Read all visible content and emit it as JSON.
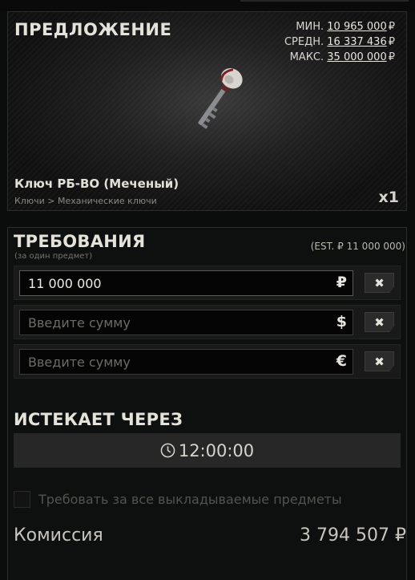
{
  "offer": {
    "title": "ПРЕДЛОЖЕНИЕ",
    "prices": [
      {
        "label": "МИН.",
        "value": "10 965 000",
        "currency": "₽"
      },
      {
        "label": "СРЕДН.",
        "value": "16 337 436",
        "currency": "₽"
      },
      {
        "label": "МАКС.",
        "value": "35 000 000",
        "currency": "₽"
      }
    ],
    "item_name": "Ключ РБ-ВО (Меченый)",
    "breadcrumb": "Ключи > Механические ключи",
    "quantity": "x1"
  },
  "requirements": {
    "title": "ТРЕБОВАНИЯ",
    "subtitle": "(за один предмет)",
    "estimate": "(EST. ₽ 11 000 000)",
    "fields": [
      {
        "value": "11 000 000",
        "placeholder": "",
        "symbol": "₽"
      },
      {
        "value": "",
        "placeholder": "Введите сумму",
        "symbol": "$"
      },
      {
        "value": "",
        "placeholder": "Введите сумму",
        "symbol": "€"
      }
    ],
    "clear_label": "✖"
  },
  "expiry": {
    "title": "ИСТЕКАЕТ ЧЕРЕЗ",
    "time": "12:00:00"
  },
  "require_all": {
    "label": "Требовать за все выкладываемые предметы",
    "checked": false
  },
  "commission": {
    "label": "Комиссия",
    "value": "3 794 507 ₽"
  }
}
